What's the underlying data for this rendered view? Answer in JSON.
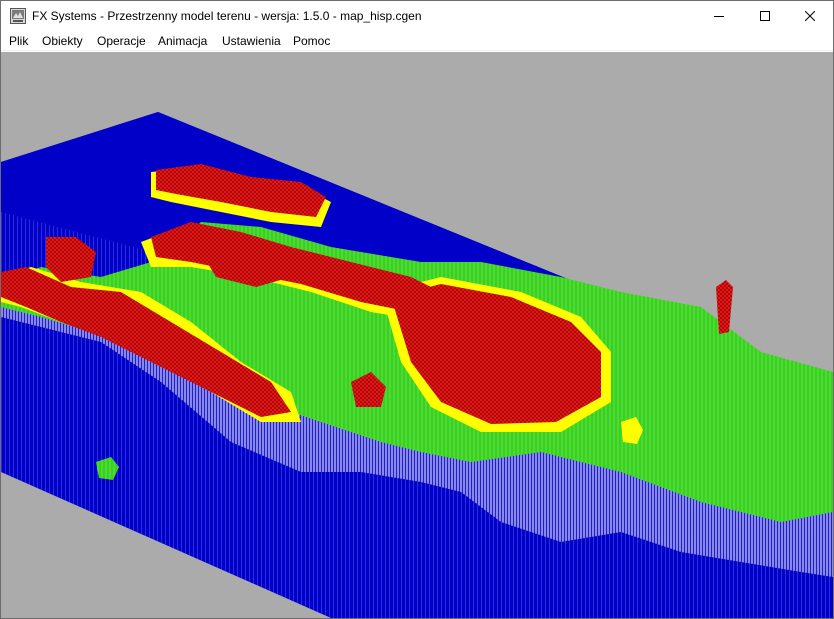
{
  "window": {
    "title": "FX Systems - Przestrzenny model terenu - wersja: 1.5.0 - map_hisp.cgen",
    "minimize_icon": "minimize-icon",
    "maximize_icon": "maximize-icon",
    "close_icon": "close-icon"
  },
  "menu": {
    "items": [
      {
        "label": "Plik"
      },
      {
        "label": "Obiekty"
      },
      {
        "label": "Operacje"
      },
      {
        "label": "Animacja"
      },
      {
        "label": "Ustawienia"
      },
      {
        "label": "Pomoc"
      }
    ]
  },
  "viewport": {
    "background_color": "#ababab",
    "sea_color": "#0000c8",
    "colors": {
      "lowland": "#22cc11",
      "midland": "#ffff00",
      "highland": "#cc0000",
      "stilt": "#e8e8ff"
    }
  }
}
